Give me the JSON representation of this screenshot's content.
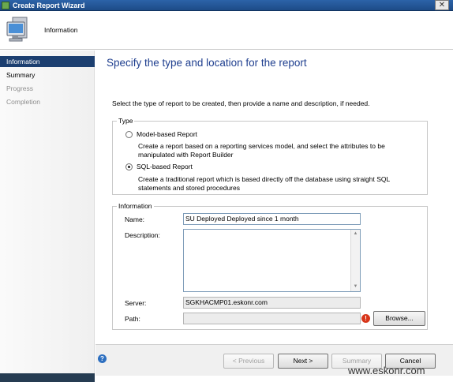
{
  "window": {
    "title": "Create Report Wizard",
    "close_glyph": "✕"
  },
  "header": {
    "title": "Information",
    "icon": "computer-icon"
  },
  "sidebar": {
    "items": [
      {
        "label": "Information",
        "active": true
      },
      {
        "label": "Summary",
        "active": false
      },
      {
        "label": "Progress",
        "active": false
      },
      {
        "label": "Completion",
        "active": false
      }
    ]
  },
  "main": {
    "title": "Specify the type and location for the report",
    "instruction": "Select the type of report to be created, then provide a name and description, if needed."
  },
  "type_group": {
    "label": "Type",
    "options": [
      {
        "label": "Model-based Report",
        "checked": false,
        "description": "Create a report based on a reporting services model, and select the attributes to be manipulated with Report Builder"
      },
      {
        "label": "SQL-based Report",
        "checked": true,
        "description": "Create a traditional report which is based directly off the database using straight SQL statements and stored procedures"
      }
    ]
  },
  "info_group": {
    "label": "Information",
    "name_label": "Name:",
    "name_value": "SU Deployed Deployed since 1 month",
    "description_label": "Description:",
    "description_value": "",
    "server_label": "Server:",
    "server_value": "SGKHACMP01.eskonr.com",
    "path_label": "Path:",
    "path_value": "",
    "browse_label": "Browse..."
  },
  "footer": {
    "previous": "< Previous",
    "next": "Next >",
    "summary": "Summary",
    "cancel": "Cancel"
  },
  "watermark": "www.eskonr.com",
  "colors": {
    "title_blue": "#1f3f8f",
    "sidebar_active": "#1c3f70",
    "error_red": "#d8361a",
    "help_blue": "#2d6fc0"
  }
}
